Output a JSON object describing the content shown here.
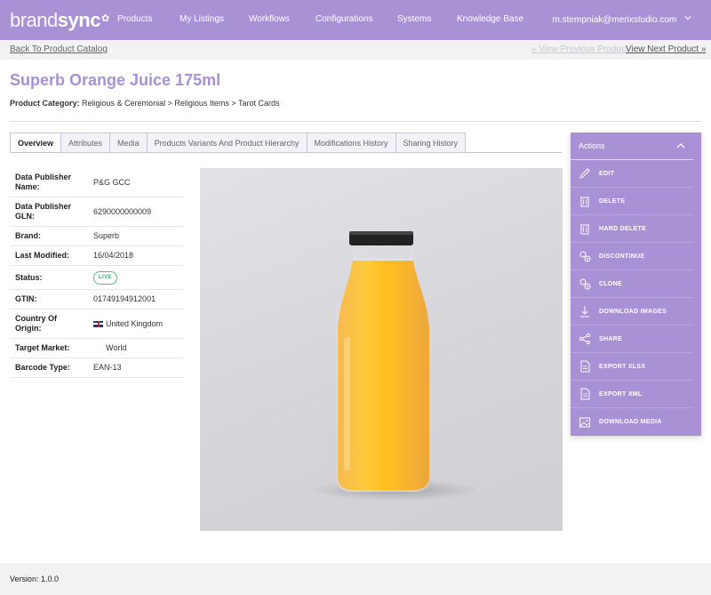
{
  "nav": {
    "logo_light": "brand",
    "logo_bold": "sync",
    "items": [
      "Products",
      "My Listings",
      "Workflows",
      "Configurations",
      "Systems",
      "Knowledge Base"
    ],
    "user": "m.stempniak@merixstudio.com"
  },
  "subnav": {
    "back": "Back To Product Catalog",
    "prev": "« View Previous Product",
    "next": "View Next Product »"
  },
  "product": {
    "title": "Superb Orange Juice 175ml",
    "category_label": "Product Category:",
    "category_path": "Religious & Ceremonial > Religious Items > Tarot Cards"
  },
  "tabs": [
    "Overview",
    "Attributes",
    "Media",
    "Products Variants And Product Hierarchy",
    "Modifications History",
    "Sharing History"
  ],
  "details": [
    {
      "k": "Data Publisher Name:",
      "v": "P&G GCC"
    },
    {
      "k": "Data Publisher GLN:",
      "v": "6290000000009"
    },
    {
      "k": "Brand:",
      "v": "Superb"
    },
    {
      "k": "Last Modified:",
      "v": "16/04/2018"
    },
    {
      "k": "Status:",
      "v": "LIVE"
    },
    {
      "k": "GTIN:",
      "v": "01749194912001"
    },
    {
      "k": "Country Of Origin:",
      "v": "United Kingdom"
    },
    {
      "k": "Target Market:",
      "v": "World"
    },
    {
      "k": "Barcode Type:",
      "v": "EAN-13"
    }
  ],
  "actions": {
    "title": "Actions",
    "items": [
      {
        "label": "EDIT",
        "icon": "pencil-icon"
      },
      {
        "label": "DELETE",
        "icon": "trash-icon"
      },
      {
        "label": "HARD DELETE",
        "icon": "trash-icon"
      },
      {
        "label": "DISCONTINUE",
        "icon": "discontinue-icon"
      },
      {
        "label": "CLONE",
        "icon": "clone-icon"
      },
      {
        "label": "DOWNLOAD IMAGES",
        "icon": "download-icon"
      },
      {
        "label": "SHARE",
        "icon": "share-icon"
      },
      {
        "label": "EXPORT XLSX",
        "icon": "file-icon"
      },
      {
        "label": "EXPORT XML",
        "icon": "file-icon"
      },
      {
        "label": "DOWNLOAD MEDIA",
        "icon": "image-icon"
      }
    ]
  },
  "footer": {
    "version": "Version: 1.0.0"
  },
  "colors": {
    "brand": "#a991d6",
    "live": "#59b889"
  }
}
